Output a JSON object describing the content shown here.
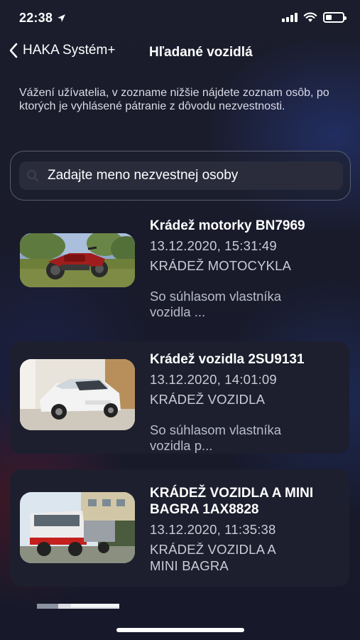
{
  "status_bar": {
    "time": "22:38"
  },
  "nav": {
    "back_label": "HAKA Systém+",
    "title": "Hľadané vozidlá"
  },
  "intro_text": "Vážení užívatelia, v zozname nižšie nájdete zoznam osôb, po ktorých je vyhlásené pátranie z dôvodu nezvestnosti.",
  "search": {
    "placeholder": "Zadajte meno nezvestnej osoby"
  },
  "items": [
    {
      "title": "Krádež motorky BN7969",
      "date": "13.12.2020, 15:31:49",
      "type": "KRÁDEŽ MOTOCYKLA",
      "desc_line1": "So súhlasom vlastníka",
      "desc_line2": "vozidla ..."
    },
    {
      "title": "Krádež vozidla 2SU9131",
      "date": "13.12.2020, 14:01:09",
      "type": "KRÁDEŽ VOZIDLA",
      "desc_line1": "So súhlasom vlastníka",
      "desc_line2": "vozidla p..."
    },
    {
      "title_line1": "KRÁDEŽ VOZIDLA A MINI",
      "title_line2": "BAGRA 1AX8828",
      "date": "13.12.2020, 11:35:38",
      "type_line1": "KRÁDEŽ VOZIDLA A",
      "type_line2": "MINI BAGRA"
    }
  ]
}
